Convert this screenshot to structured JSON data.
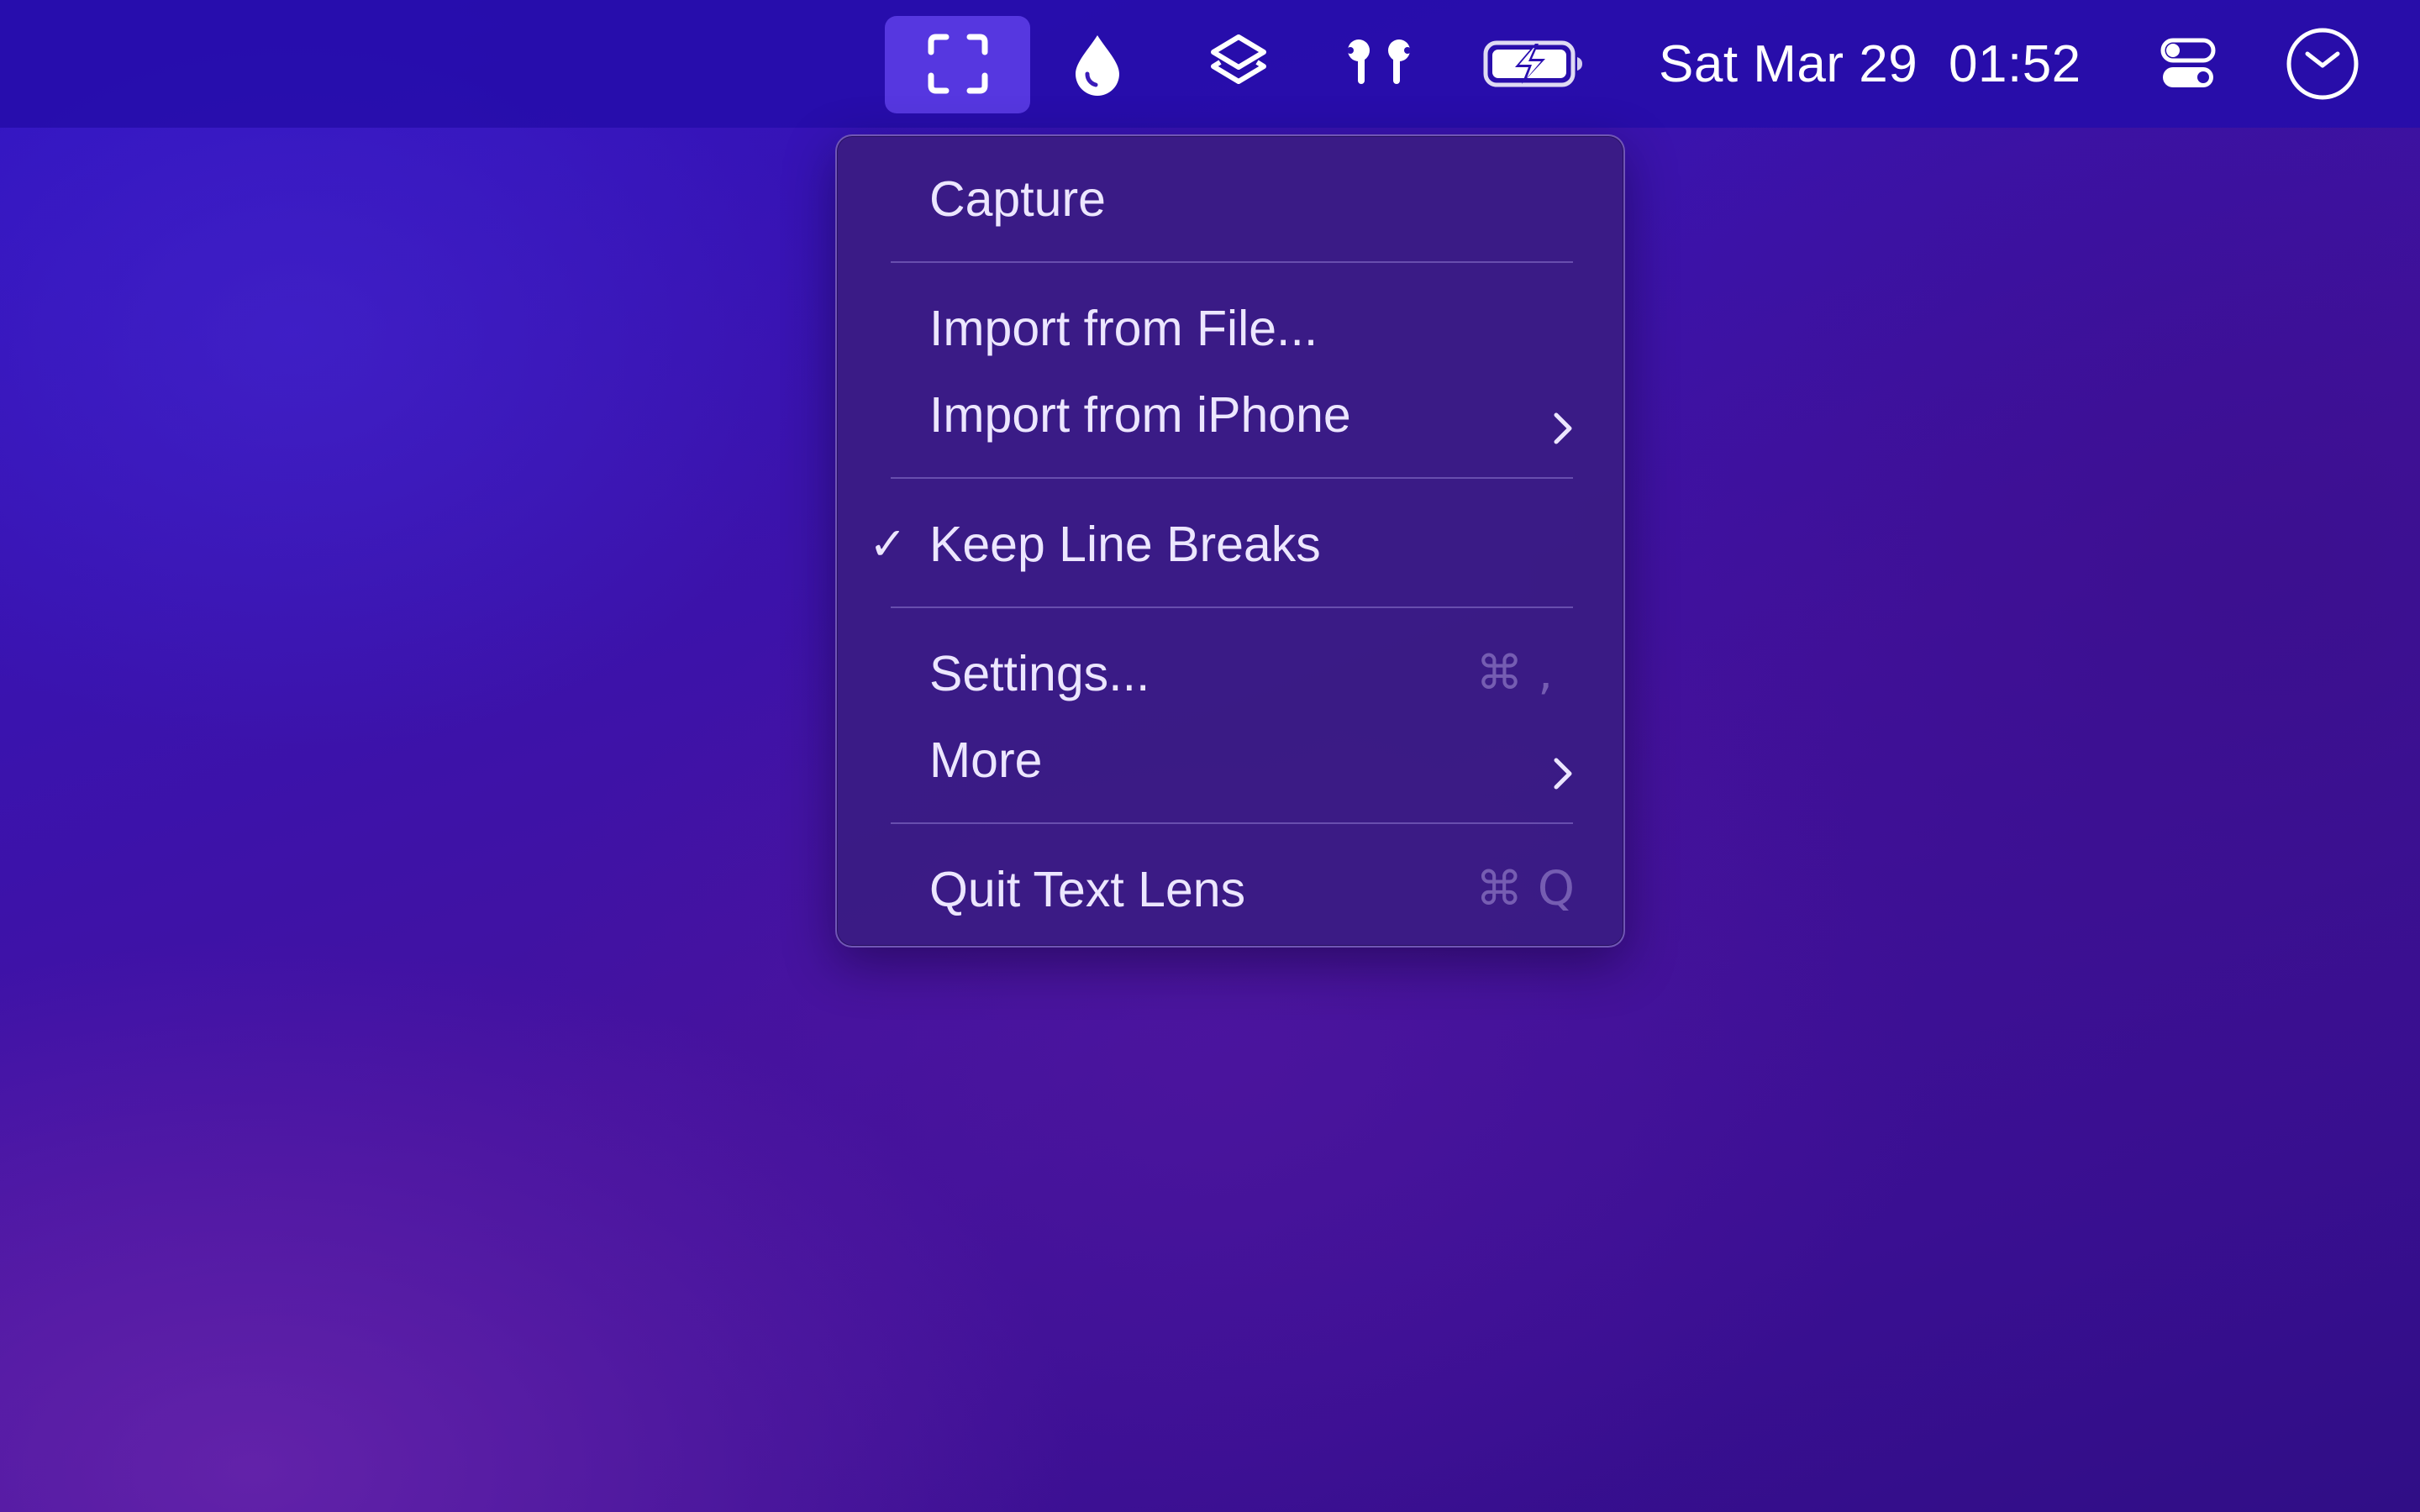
{
  "menubar": {
    "icons": [
      {
        "name": "text-lens-capture-icon",
        "active": true
      },
      {
        "name": "drop-icon"
      },
      {
        "name": "layers-icon"
      },
      {
        "name": "airpods-icon"
      },
      {
        "name": "battery-charging-icon"
      }
    ],
    "date": "Sat Mar 29",
    "time": "01:52",
    "control_center_icon": "control-center-icon",
    "clock_icon": "clock-icon"
  },
  "menu": {
    "items": [
      {
        "label": "Capture"
      },
      {
        "label": "Import from File..."
      },
      {
        "label": "Import from iPhone",
        "submenu": true
      },
      {
        "label": "Keep Line Breaks",
        "checked": true
      },
      {
        "label": "Settings...",
        "shortcut": "⌘ ,"
      },
      {
        "label": "More",
        "submenu": true
      },
      {
        "label": "Quit Text Lens",
        "shortcut": "⌘ Q"
      }
    ]
  },
  "colors": {
    "menubar_bg": "#2a0fb0",
    "active_icon_bg": "#5637e0",
    "menu_bg": "#3a1c84",
    "menu_text": "#ece6ff"
  }
}
